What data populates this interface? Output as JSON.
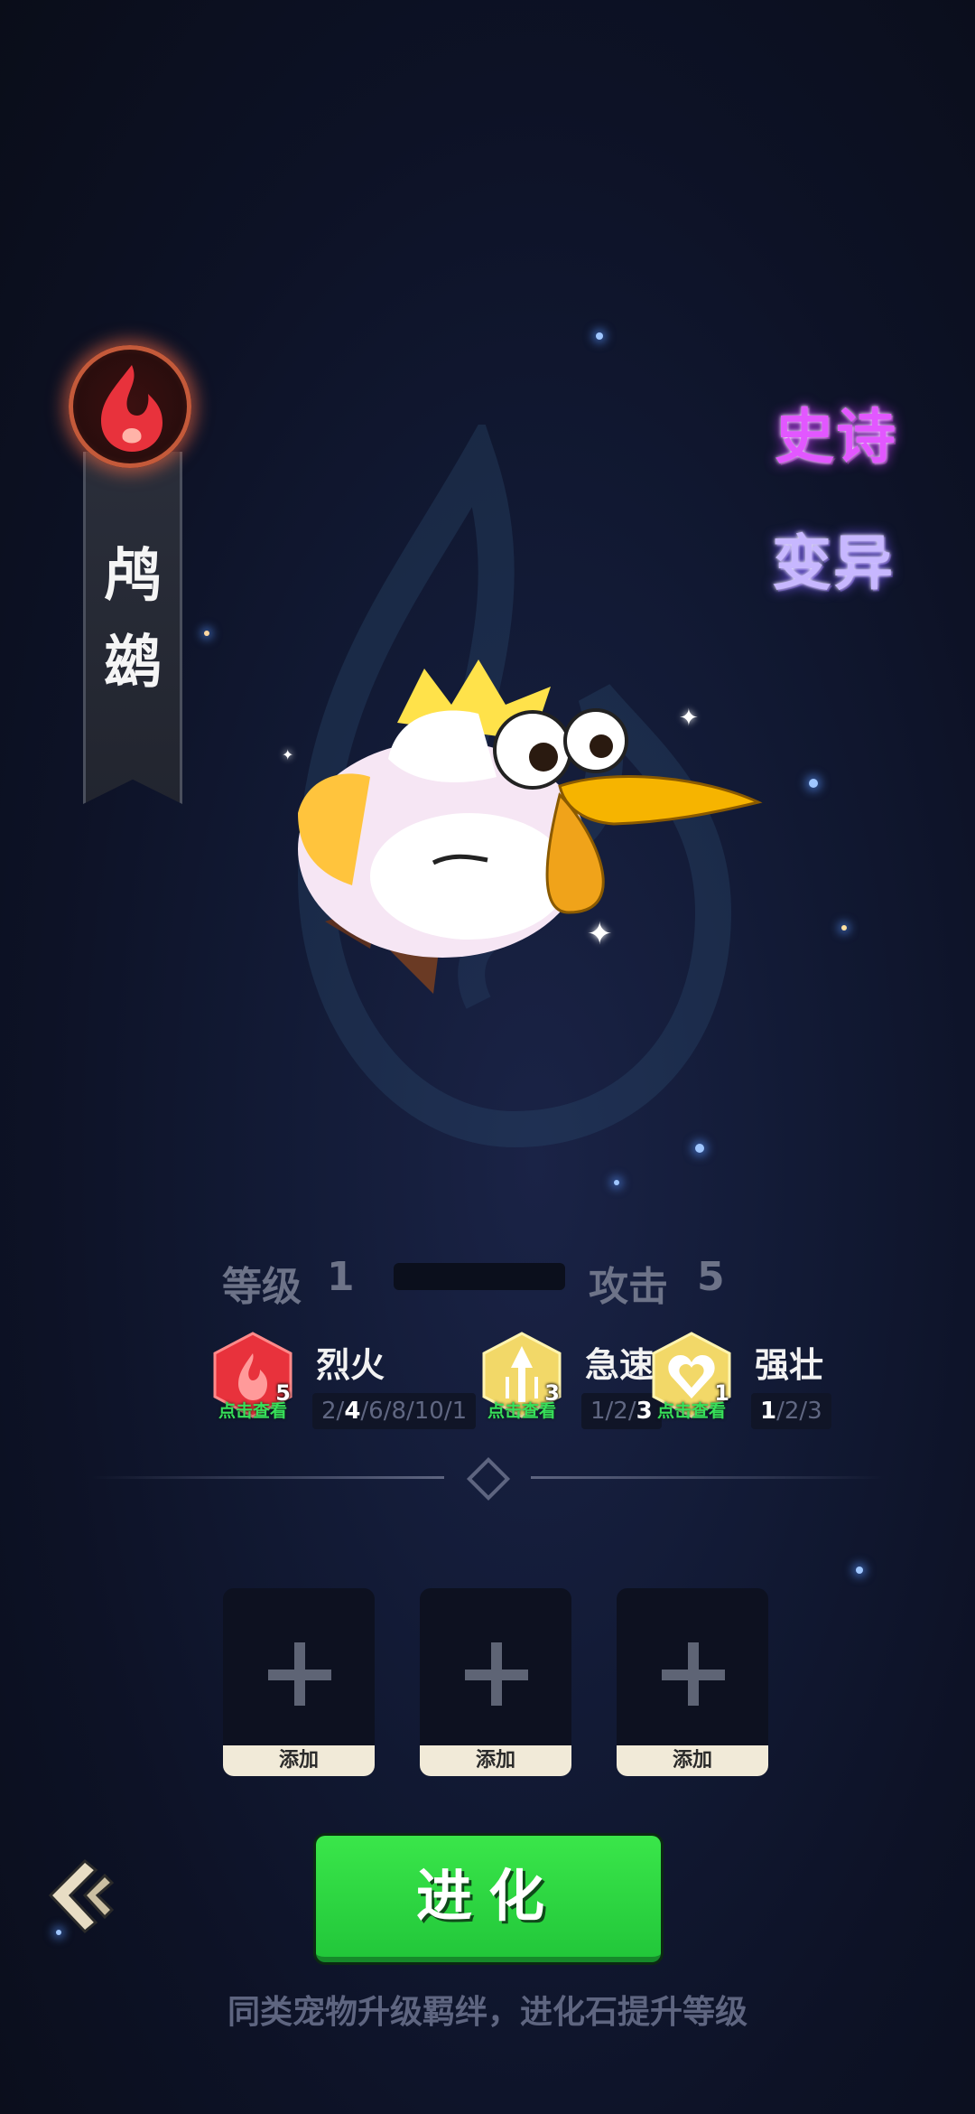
{
  "pet": {
    "name": "鸬鹚",
    "element_icon": "fire-icon",
    "tags": [
      "史诗",
      "变异"
    ]
  },
  "stats": {
    "level_label": "等级",
    "level_value": "1",
    "level_progress": 0,
    "attack_label": "攻击",
    "attack_value": "5"
  },
  "bonds": [
    {
      "name": "烈火",
      "icon": "fire-drop-icon",
      "color": "#e8323c",
      "count": "5",
      "view_label": "点击查看",
      "tiers": [
        "2",
        "4",
        "6",
        "8",
        "10",
        "1"
      ],
      "active_tier": 1
    },
    {
      "name": "急速",
      "icon": "speed-arrow-icon",
      "color": "#f2d868",
      "count": "3",
      "view_label": "点击查看",
      "tiers": [
        "1",
        "2",
        "3"
      ],
      "active_tier": 2
    },
    {
      "name": "强壮",
      "icon": "heart-icon",
      "color": "#f2d868",
      "count": "1",
      "view_label": "点击查看",
      "tiers": [
        "1",
        "2",
        "3"
      ],
      "active_tier": 0
    }
  ],
  "slots": [
    {
      "label": "添加"
    },
    {
      "label": "添加"
    },
    {
      "label": "添加"
    }
  ],
  "actions": {
    "evolve_label": "进化",
    "hint": "同类宠物升级羁绊，进化石提升等级",
    "back_icon": "double-chevron-left-icon"
  },
  "colors": {
    "evolve_green": "#2fd942",
    "epic_purple": "#e257ff",
    "mutant_lavender": "#c7b7ff",
    "fire_red": "#e8323c"
  }
}
